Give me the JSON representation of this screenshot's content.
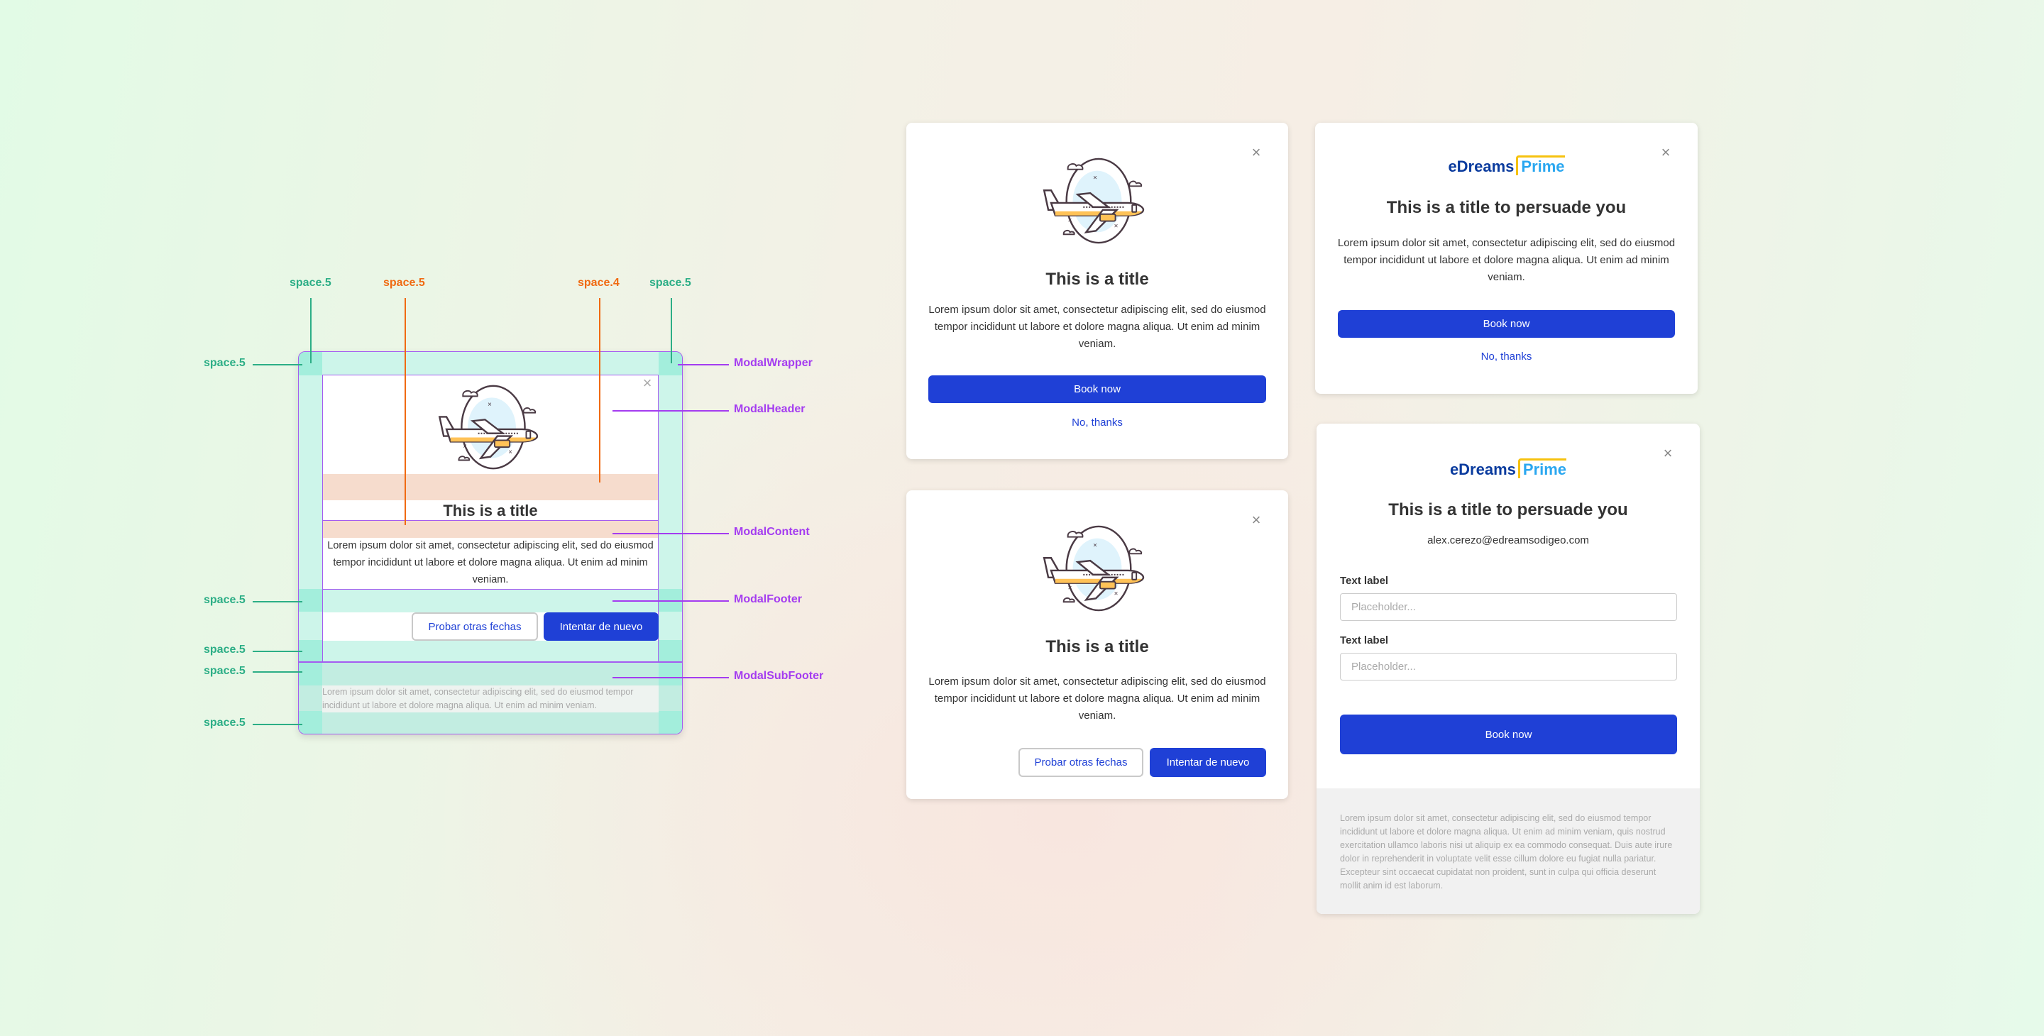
{
  "colors": {
    "primary": "#1f40d6",
    "spacing_green": "#2cae86",
    "spacing_orange": "#f06a12",
    "component_purple": "#a43cf0"
  },
  "anatomy": {
    "top_labels": [
      "space.5",
      "space.5",
      "space.4",
      "space.5"
    ],
    "left_labels": [
      "space.5",
      "space.5",
      "space.5",
      "space.5",
      "space.5"
    ],
    "right_labels": [
      "ModalWrapper",
      "ModalHeader",
      "ModalContent",
      "ModalFooter",
      "ModalSubFooter"
    ],
    "title": "This is a title",
    "body": "Lorem ipsum dolor sit amet, consectetur adipiscing elit, sed do eiusmod tempor incididunt ut labore et dolore magna aliqua. Ut enim ad minim veniam.",
    "secondary_button": "Probar otras fechas",
    "primary_button": "Intentar de nuevo",
    "subfooter": "Lorem ipsum dolor sit amet, consectetur adipiscing elit, sed do eiusmod tempor incididunt ut labore et dolore magna aliqua. Ut enim ad minim veniam.",
    "close_icon": "×"
  },
  "modal_a": {
    "close_icon": "×",
    "title": "This is a title",
    "body": "Lorem ipsum dolor sit amet, consectetur adipiscing elit, sed do eiusmod tempor incididunt ut labore et dolore magna aliqua. Ut enim ad minim veniam.",
    "primary_button": "Book now",
    "link": "No, thanks"
  },
  "modal_b": {
    "close_icon": "×",
    "title": "This is a title",
    "body": "Lorem ipsum dolor sit amet, consectetur adipiscing elit, sed do eiusmod tempor incididunt ut labore et dolore magna aliqua. Ut enim ad minim veniam.",
    "secondary_button": "Probar otras fechas",
    "primary_button": "Intentar de nuevo"
  },
  "modal_c": {
    "close_icon": "×",
    "logo_a": "eDreams",
    "logo_b": "Prime",
    "title": "This is a title to persuade you",
    "body": "Lorem ipsum dolor sit amet, consectetur adipiscing elit, sed do eiusmod tempor incididunt ut labore et dolore magna aliqua. Ut enim ad minim veniam.",
    "primary_button": "Book now",
    "link": "No, thanks"
  },
  "modal_d": {
    "close_icon": "×",
    "logo_a": "eDreams",
    "logo_b": "Prime",
    "title": "This is a title to persuade you",
    "email": "alex.cerezo@edreamsodigeo.com",
    "fields": [
      {
        "label": "Text label",
        "placeholder": "Placeholder..."
      },
      {
        "label": "Text label",
        "placeholder": "Placeholder..."
      }
    ],
    "primary_button": "Book now",
    "footer": "Lorem ipsum dolor sit amet, consectetur adipiscing elit, sed do eiusmod tempor incididunt ut labore et dolore magna aliqua. Ut enim ad minim veniam, quis nostrud exercitation ullamco laboris nisi ut aliquip ex ea commodo consequat. Duis aute irure dolor in reprehenderit in voluptate velit esse cillum dolore eu fugiat nulla pariatur. Excepteur sint occaecat cupidatat non proident, sunt in culpa qui officia deserunt mollit anim id est laborum."
  }
}
